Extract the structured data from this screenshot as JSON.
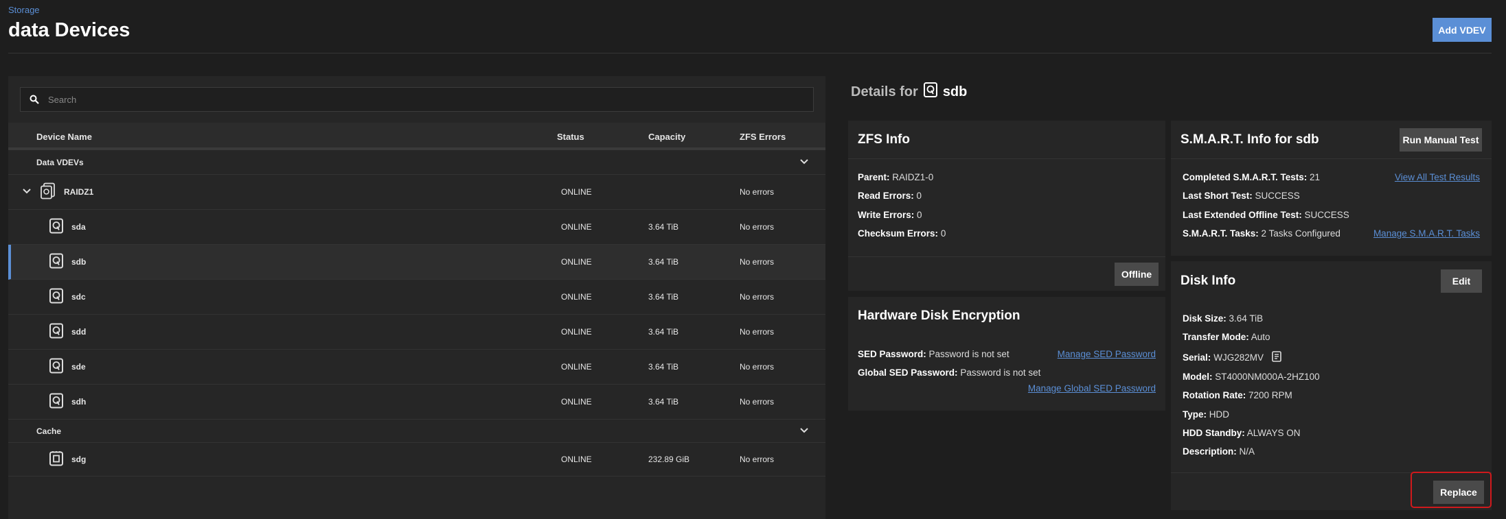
{
  "header": {
    "breadcrumb": "Storage",
    "title": "data Devices",
    "add_vdev_label": "Add VDEV"
  },
  "search": {
    "placeholder": "Search"
  },
  "table": {
    "columns": [
      "Device Name",
      "Status",
      "Capacity",
      "ZFS Errors"
    ],
    "groups": [
      {
        "label": "Data VDEVs",
        "vdev": {
          "name": "RAIDZ1",
          "status": "ONLINE",
          "capacity": "",
          "errors": "No errors"
        },
        "devices": [
          {
            "name": "sda",
            "status": "ONLINE",
            "capacity": "3.64 TiB",
            "errors": "No errors"
          },
          {
            "name": "sdb",
            "status": "ONLINE",
            "capacity": "3.64 TiB",
            "errors": "No errors"
          },
          {
            "name": "sdc",
            "status": "ONLINE",
            "capacity": "3.64 TiB",
            "errors": "No errors"
          },
          {
            "name": "sdd",
            "status": "ONLINE",
            "capacity": "3.64 TiB",
            "errors": "No errors"
          },
          {
            "name": "sde",
            "status": "ONLINE",
            "capacity": "3.64 TiB",
            "errors": "No errors"
          },
          {
            "name": "sdh",
            "status": "ONLINE",
            "capacity": "3.64 TiB",
            "errors": "No errors"
          }
        ]
      },
      {
        "label": "Cache",
        "devices": [
          {
            "name": "sdg",
            "status": "ONLINE",
            "capacity": "232.89 GiB",
            "errors": "No errors"
          }
        ]
      }
    ]
  },
  "details": {
    "prefix": "Details for",
    "device": "sdb"
  },
  "zfs_info": {
    "title": "ZFS Info",
    "parent_label": "Parent:",
    "parent": "RAIDZ1-0",
    "read_label": "Read Errors:",
    "read": "0",
    "write_label": "Write Errors:",
    "write": "0",
    "checksum_label": "Checksum Errors:",
    "checksum": "0",
    "offline_label": "Offline"
  },
  "encryption": {
    "title": "Hardware Disk Encryption",
    "sed_label": "SED Password:",
    "sed": "Password is not set",
    "global_label": "Global SED Password:",
    "global": "Password is not set",
    "manage_sed": "Manage SED Password",
    "manage_global": "Manage Global SED Password"
  },
  "smart": {
    "title": "S.M.A.R.T. Info for sdb",
    "run_label": "Run Manual Test",
    "completed_label": "Completed S.M.A.R.T. Tests:",
    "completed": "21",
    "short_label": "Last Short Test:",
    "short": "SUCCESS",
    "extended_label": "Last Extended Offline Test:",
    "extended": "SUCCESS",
    "tasks_label": "S.M.A.R.T. Tasks:",
    "tasks": "2 Tasks Configured",
    "view_all": "View All Test Results",
    "manage_tasks": "Manage S.M.A.R.T. Tasks"
  },
  "disk_info": {
    "title": "Disk Info",
    "edit_label": "Edit",
    "size_label": "Disk Size:",
    "size": "3.64 TiB",
    "transfer_label": "Transfer Mode:",
    "transfer": "Auto",
    "serial_label": "Serial:",
    "serial": "WJG282MV",
    "model_label": "Model:",
    "model": "ST4000NM000A-2HZ100",
    "rotation_label": "Rotation Rate:",
    "rotation": "7200 RPM",
    "type_label": "Type:",
    "type": "HDD",
    "standby_label": "HDD Standby:",
    "standby": "ALWAYS ON",
    "desc_label": "Description:",
    "desc": "N/A",
    "replace_label": "Replace"
  },
  "colors": {
    "accent": "#5b8fd6",
    "highlight": "#d0191c",
    "background": "#1e1e1e",
    "card": "#262626"
  }
}
